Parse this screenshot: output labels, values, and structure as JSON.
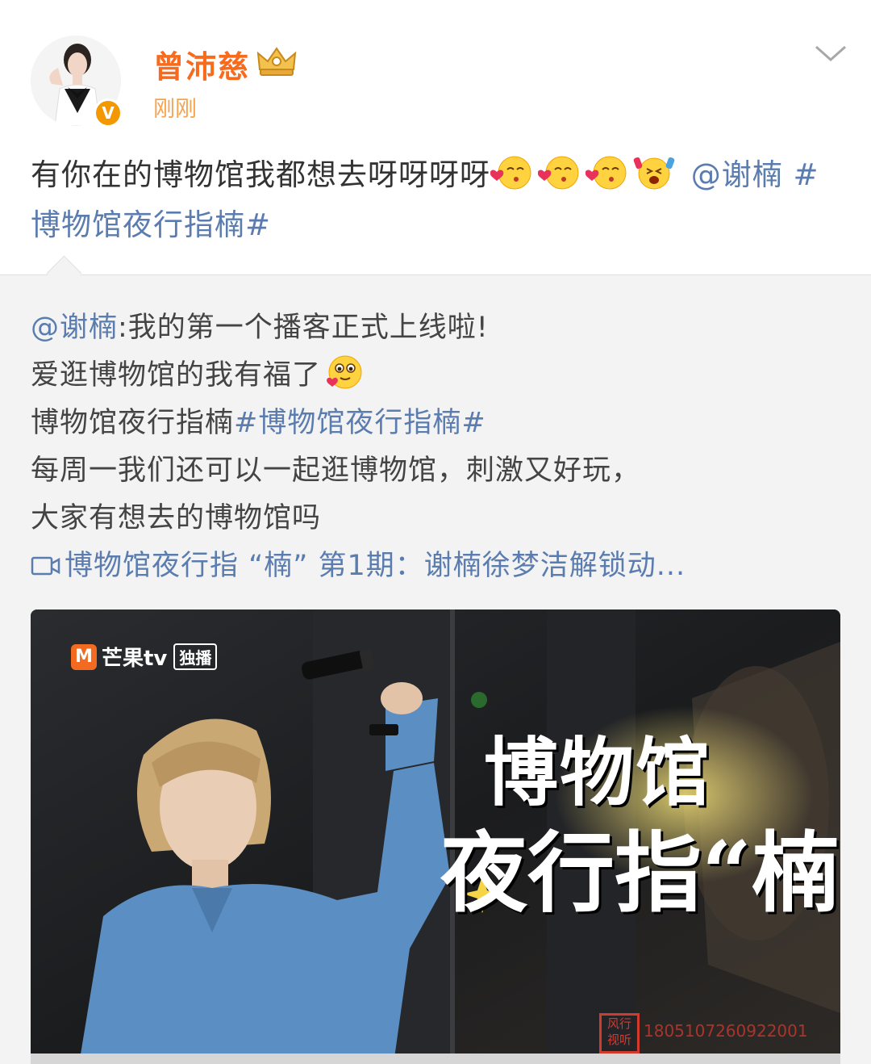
{
  "post": {
    "username": "曾沛慈",
    "timestamp": "刚刚",
    "verified_badge": "V",
    "text_main": "有你在的博物馆我都想去呀呀呀呀",
    "emoji_icons": [
      "kiss-heart-emoji",
      "kiss-heart-emoji",
      "kiss-heart-emoji",
      "cheering-emoji"
    ],
    "mention": "@谢楠",
    "hashtag": "#博物馆夜行指楠#"
  },
  "repost": {
    "author": "@谢楠",
    "line1_rest": ":我的第一个播客正式上线啦!",
    "line2": "爱逛博物馆的我有福了",
    "line3_text": "博物馆夜行指楠",
    "line3_hashtag": "#博物馆夜行指楠#",
    "line4": "每周一我们还可以一起逛博物馆，刺激又好玩，",
    "line5": "大家有想去的博物馆吗",
    "video_link": "博物馆夜行指 “楠” 第1期：谢楠徐梦洁解锁动..."
  },
  "thumbnail": {
    "logo_text": "芒果tv",
    "logo_tag": "独播",
    "title_line1": "博物馆",
    "title_line2": "夜行指“楠”",
    "stamp_text": "风行视听",
    "serial_number": "1805107260922001"
  },
  "colors": {
    "username": "#f86b1d",
    "timestamp": "#f7a24d",
    "link": "#5b7caf",
    "repost_bg": "#f3f3f3",
    "badge": "#f39800"
  }
}
